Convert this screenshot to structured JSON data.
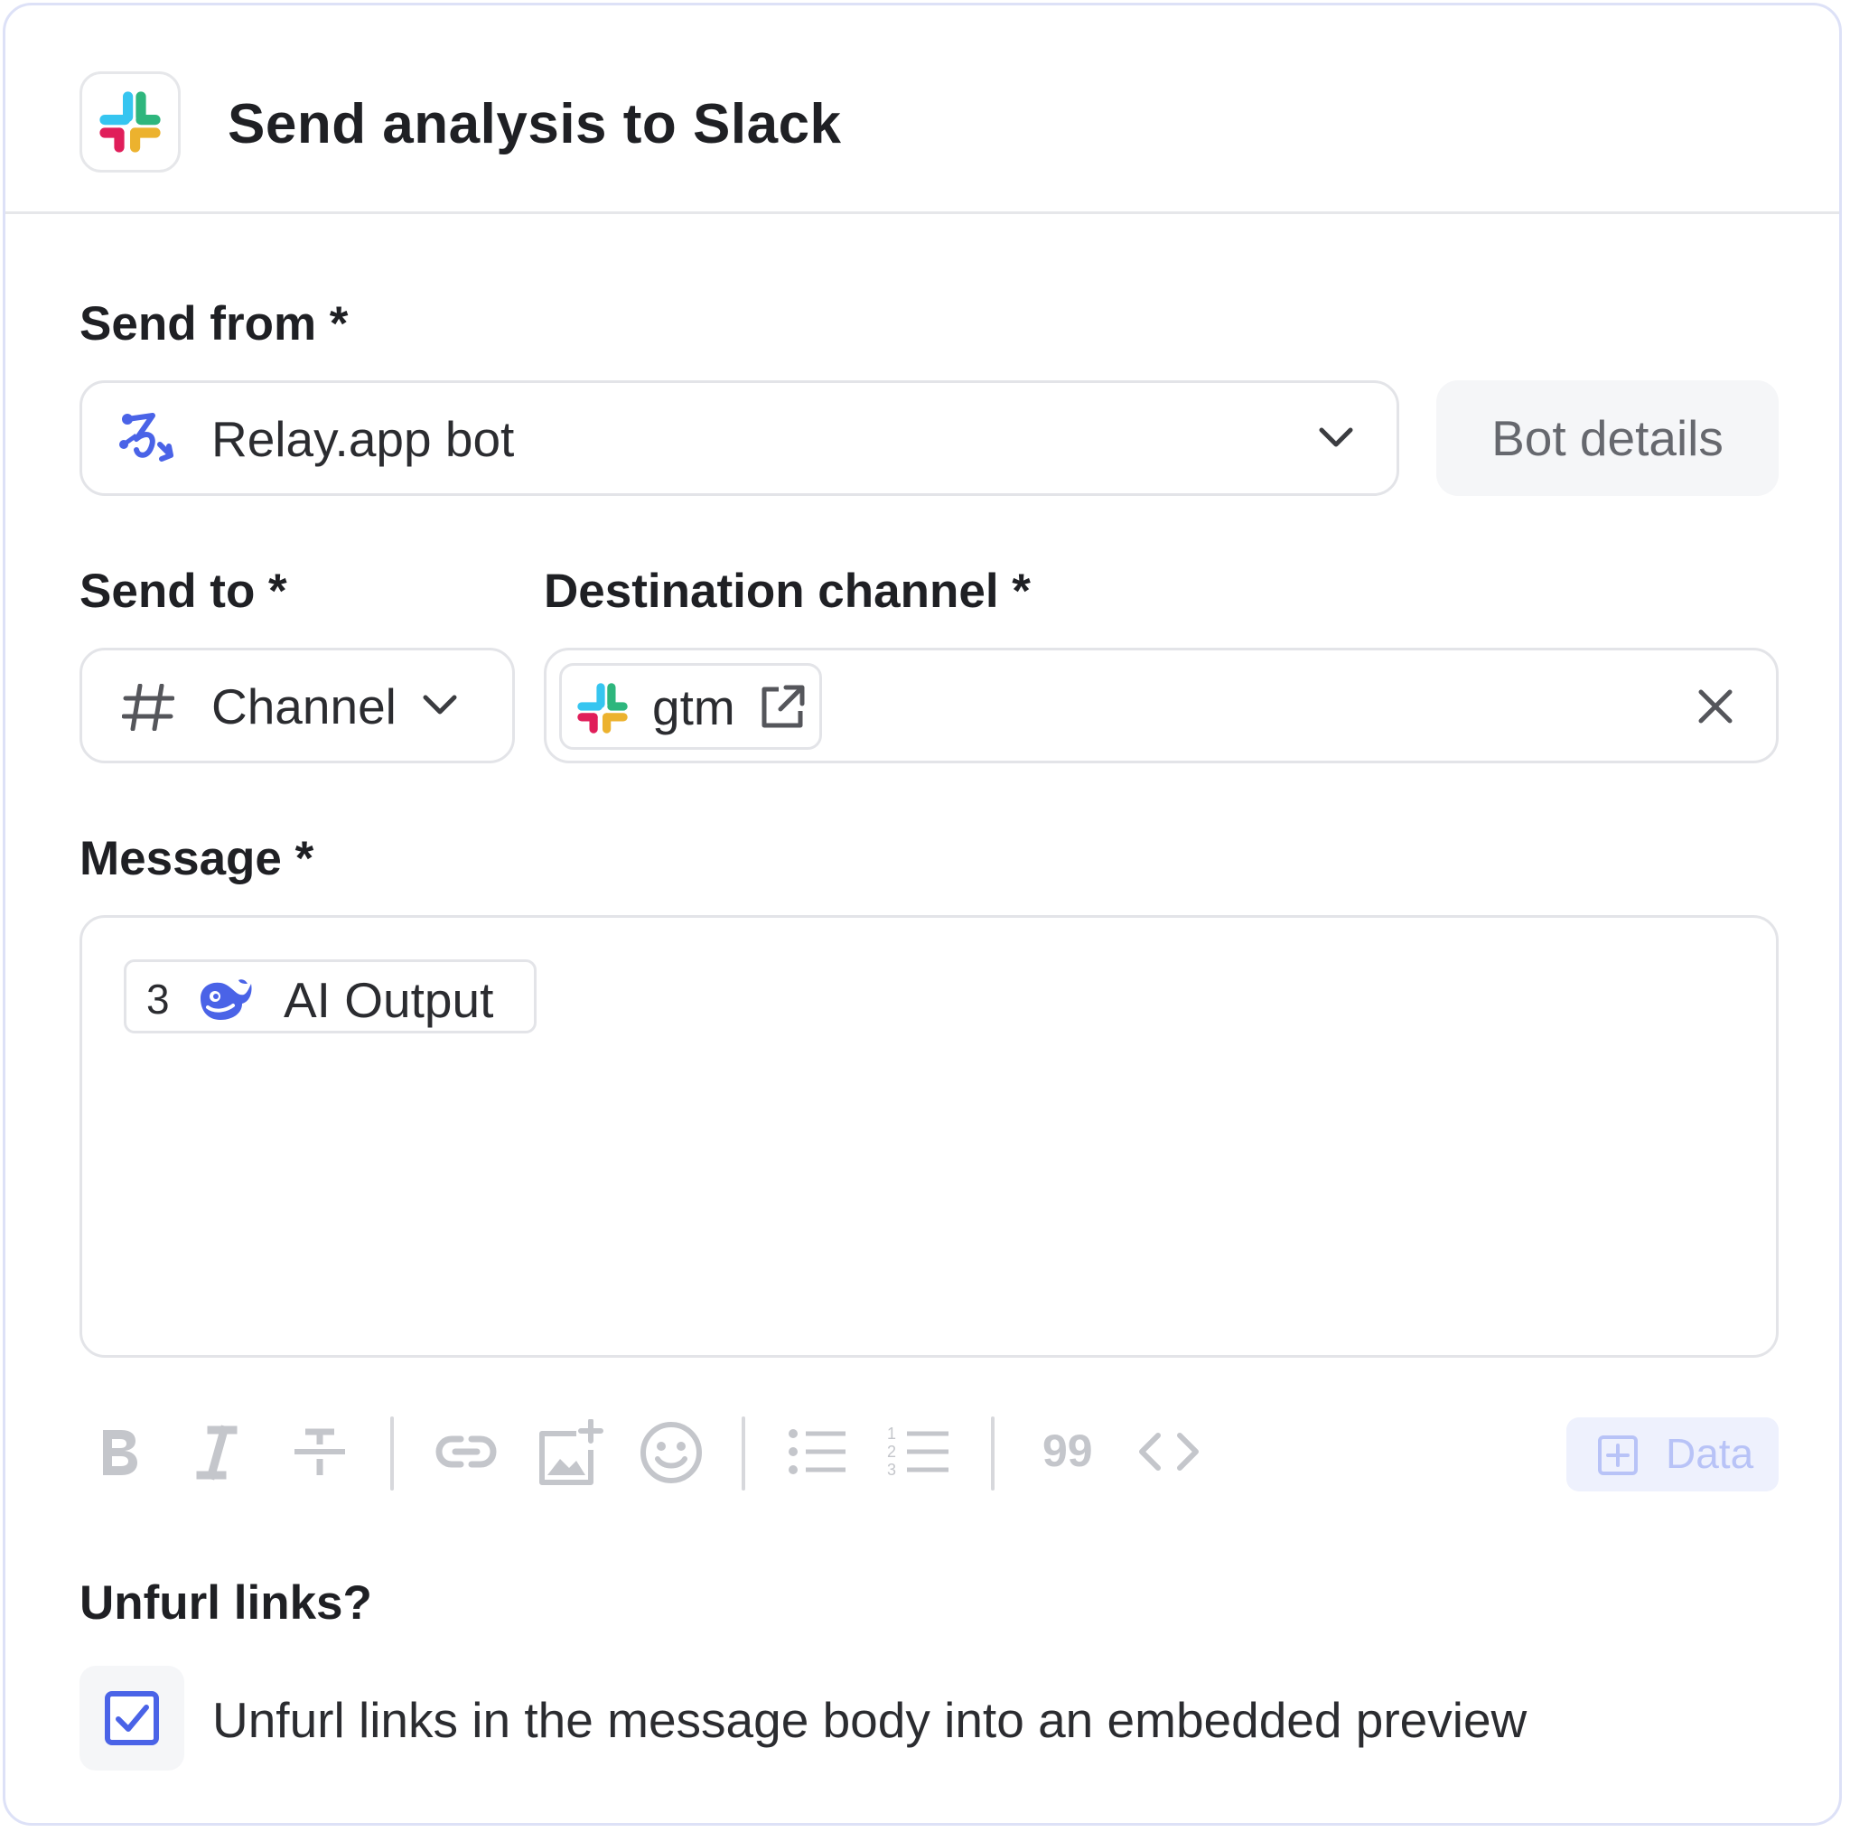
{
  "header": {
    "title": "Send analysis to Slack",
    "app_icon": "slack-icon"
  },
  "send_from": {
    "label": "Send from *",
    "value": "Relay.app bot",
    "icon": "relay-icon",
    "bot_details_label": "Bot details"
  },
  "send_to": {
    "label": "Send to *",
    "value": "Channel",
    "icon": "hash-icon"
  },
  "destination": {
    "label": "Destination channel *",
    "channel": "gtm"
  },
  "message": {
    "label": "Message *",
    "token_step": "3",
    "token_label": "AI Output",
    "token_icon": "whale-icon"
  },
  "toolbar": {
    "items": [
      "bold",
      "italic",
      "strikethrough",
      "link",
      "image",
      "emoji",
      "bulleted-list",
      "numbered-list",
      "quote",
      "code"
    ],
    "quote_glyph": "99",
    "data_label": "Data"
  },
  "unfurl": {
    "label": "Unfurl links?",
    "checkbox_label": "Unfurl links in the message body into an embedded preview",
    "checked": true
  },
  "colors": {
    "accent": "#4a63e7",
    "slack_blue": "#36C5F0",
    "slack_green": "#2EB67D",
    "slack_red": "#E01E5A",
    "slack_yellow": "#ECB22E"
  }
}
